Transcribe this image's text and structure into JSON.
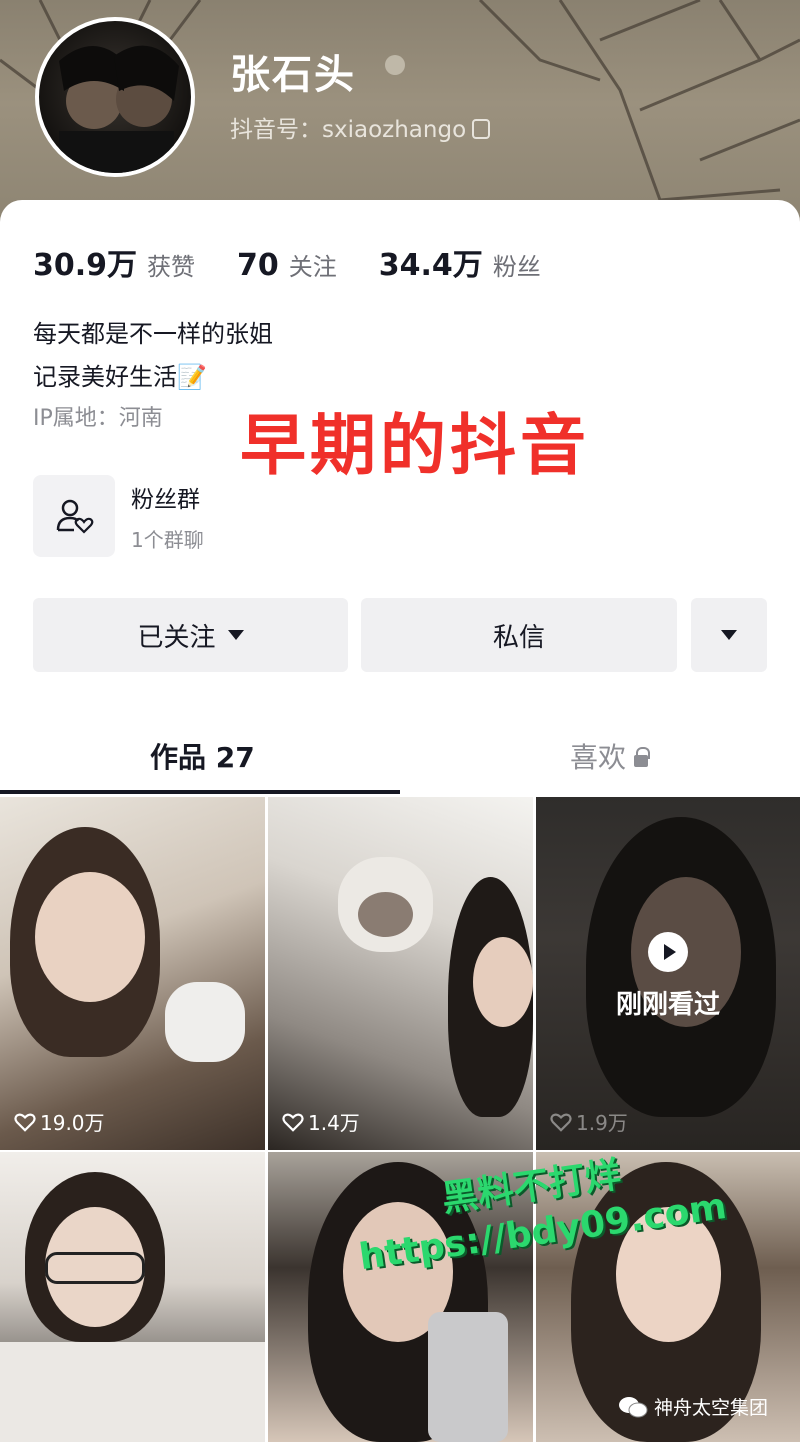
{
  "profile": {
    "name": "张石头",
    "douyin_id": "抖音号：sxiaozhango"
  },
  "stats": [
    {
      "num": "30.9万",
      "label": "获赞"
    },
    {
      "num": "70",
      "label": "关注"
    },
    {
      "num": "34.4万",
      "label": "粉丝"
    }
  ],
  "bio": {
    "line1": "每天都是不一样的张姐",
    "line2": "记录美好生活📝",
    "ip": "IP属地：河南"
  },
  "overlay_caption": "早期的抖音",
  "fan_group": {
    "title": "粉丝群",
    "sub": "1个群聊"
  },
  "actions": {
    "follow": "已关注",
    "message": "私信"
  },
  "tabs": {
    "works": "作品 27",
    "likes": "喜欢"
  },
  "videos": [
    {
      "likes": "19.0万"
    },
    {
      "likes": "1.4万"
    },
    {
      "likes": "1.9万",
      "watched": "刚刚看过"
    }
  ],
  "watermark": {
    "line1": "黑料不打烊",
    "line2": "https://bdy09.com"
  },
  "source_tag": "神舟太空集团",
  "colors": {
    "caption_red": "#f0302a",
    "watermark_green": "#2bd86e",
    "text_primary": "#161823",
    "text_secondary": "#8c8d93"
  }
}
